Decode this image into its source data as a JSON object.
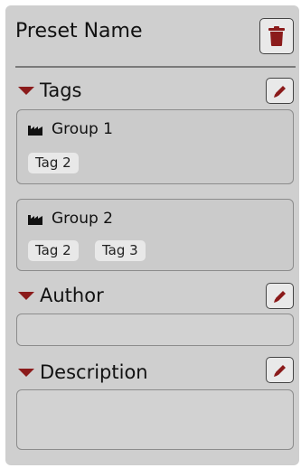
{
  "panel": {
    "title": "Preset Name",
    "delete_icon": "trash-icon"
  },
  "sections": {
    "tags": {
      "label": "Tags",
      "edit_icon": "pencil-icon",
      "groups": [
        {
          "name": "Group 1",
          "icon": "factory-icon",
          "tags": [
            "Tag 2"
          ]
        },
        {
          "name": "Group 2",
          "icon": "factory-icon",
          "tags": [
            "Tag 2",
            "Tag 3"
          ]
        }
      ]
    },
    "author": {
      "label": "Author",
      "value": "",
      "edit_icon": "pencil-icon"
    },
    "description": {
      "label": "Description",
      "value": "",
      "edit_icon": "pencil-icon"
    }
  },
  "colors": {
    "accent": "#8b1b1b",
    "panel_bg": "#cfcfcf"
  }
}
